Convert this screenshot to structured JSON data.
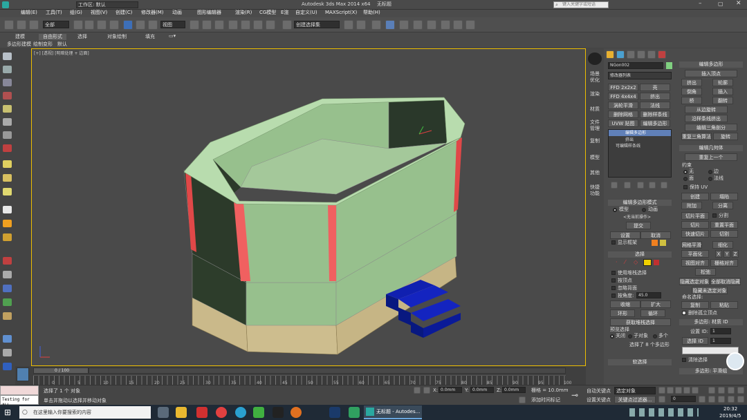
{
  "title_bar": {
    "workspace_label": "工作区: 默认",
    "app_title": "Autodesk 3ds Max  2014 x64",
    "doc_title": "无标题",
    "search_placeholder": "键入关键字或短语"
  },
  "menu": [
    "编辑(E)",
    "工具(T)",
    "组(G)",
    "视图(V)",
    "创建(C)",
    "修改器(M)",
    "动画",
    "图形编辑器",
    "渲染(R)",
    "CG模型",
    "E渲",
    "自定义(U)",
    "MAXScript(X)",
    "帮助(H)"
  ],
  "toolbar": {
    "selection_filter": "全部",
    "ref_coord": "视图",
    "named_selection": "创建选择集"
  },
  "ribbon": {
    "tabs": [
      "建模",
      "自由形式",
      "选择",
      "对象绘制",
      "填充"
    ],
    "subtabs": [
      "多边形建模",
      "绘制变形",
      "默认"
    ]
  },
  "viewport": {
    "label": "[+] [透视] [明暗处理 + 边面]"
  },
  "right_tabs": [
    "场景优化",
    "渲染",
    "材质",
    "文件管理",
    "复制",
    "模型",
    "其他",
    "快捷功能"
  ],
  "modify_panel": {
    "object_name": "NGon002",
    "modifier_list": "修改器列表",
    "modifier_buttons": [
      "FFD 2x2x2",
      "壳",
      "FFD 4x4x4",
      "挤出",
      "涡轮平滑",
      "法线",
      "删除网格",
      "删除样条线",
      "UVW 贴图",
      "编辑多边形"
    ],
    "stack": [
      "编辑多边形",
      "挤出",
      "可编辑样条线"
    ]
  },
  "edit_poly_mode": {
    "header": "编辑多边形模式",
    "model": "模型",
    "animate": "动画",
    "no_recent": "<无当前操作>",
    "commit": "提交",
    "settings": "设置",
    "cancel": "取消",
    "show_cage": "显示框架"
  },
  "selection": {
    "header": "选择",
    "by_vertex": "使用堆栈选择",
    "by_vertex2": "按顶点",
    "ignore_backfacing": "忽略背面",
    "by_angle": "按角度:",
    "angle_value": "45.0",
    "shrink": "收缩",
    "grow": "扩大",
    "ring": "环形",
    "loop": "循环",
    "get_stack": "获取堆栈选择",
    "preview_label": "预览选择",
    "off": "关闭",
    "subobj": "子对象",
    "multi": "多个",
    "status": "选择了 8 个多边形"
  },
  "soft_selection": "软选择",
  "edit_polygons": {
    "header": "编辑多边形",
    "insert_vertex": "插入顶点",
    "buttons": [
      [
        "挤出",
        "轮廓"
      ],
      [
        "倒角",
        "插入"
      ],
      [
        "桥",
        "翻转"
      ]
    ],
    "hinge": "从边旋转",
    "extrude_spline": "沿样条线挤出",
    "edit_tri": "编辑三角剖分",
    "retri": "重复三角算法",
    "turn": "旋转"
  },
  "edit_geometry": {
    "header": "编辑几何体",
    "repeat_last": "重复上一个",
    "constraints": "约束",
    "none": "无",
    "edge": "边",
    "face": "面",
    "normal": "法线",
    "preserve_uv": "保持 UV",
    "create": "创建",
    "collapse": "塌陷",
    "attach": "附加",
    "detach": "分离",
    "slice_plane": "切片平面",
    "split": "分割",
    "slice": "切片",
    "reset_plane": "重置平面",
    "quickslice": "快速切片",
    "cut": "切割",
    "meshsmooth": "网格平滑",
    "tessellate": "细化",
    "planarize": "平面化",
    "x": "X",
    "y": "Y",
    "z": "Z",
    "view_align": "视图对齐",
    "grid_align": "栅格对齐",
    "relax": "松弛",
    "hide_sel": "隐藏选定对象",
    "unhide_all": "全部取消隐藏",
    "hide_unsel": "隐藏未选定对象",
    "named_sel": "命名选择:",
    "copy": "复制",
    "paste": "粘贴",
    "delete_iso": "删除孤立顶点"
  },
  "material_ids": {
    "header": "多边形: 材质 ID",
    "set_id": "设置 ID:",
    "set_id_val": "1",
    "select_id": "选择 ID",
    "select_id_val": "1",
    "clear_sel": "清除选择"
  },
  "smoothing": "多边形: 平滑组",
  "timeline": {
    "frame": "0 / 100",
    "ticks": [
      "0",
      "5",
      "10",
      "15",
      "20",
      "25",
      "30",
      "35",
      "40",
      "45",
      "50",
      "55",
      "60",
      "65",
      "70",
      "75",
      "80",
      "85",
      "90",
      "95",
      "100"
    ]
  },
  "status": {
    "testing": "Testing for ALL",
    "selected": "选择了 1 个 对象",
    "prompt": "单击并拖动以选择并移动对象",
    "x": "0.0mm",
    "y": "0.0mm",
    "z": "0.0mm",
    "grid": "栅格 = 10.0mm",
    "add_time_tag": "添加时间标记",
    "auto_key": "自动关键点",
    "set_key": "设置关键点",
    "key_filter": "选定对象",
    "key_filters": "关键点过滤器...",
    "frame_val": "0"
  },
  "taskbar": {
    "search": "在这里输入你要搜索的内容",
    "active_app": "无标题 - Autodes...",
    "time": "20:32",
    "date": "2019/4/5"
  }
}
